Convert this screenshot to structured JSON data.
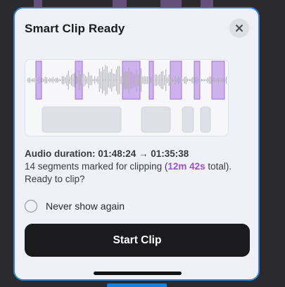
{
  "dialog": {
    "title": "Smart Clip Ready",
    "close_icon": "close-icon"
  },
  "waveform": {
    "clip_color": "#cdb2ec",
    "clip_edge_color": "#a470d6",
    "wave_color": "#b9b9c2",
    "block_color": "#dfe0e5"
  },
  "info": {
    "duration_label": "Audio duration: 01:48:24 → 01:35:38",
    "summary_before": "14 segments marked for clipping (",
    "summary_highlight": "12m 42s",
    "summary_after": " total). Ready to clip?",
    "highlight_color": "#9b4fc9"
  },
  "never_show": {
    "label": "Never show again",
    "checked": false
  },
  "start_button": {
    "label": "Start Clip"
  }
}
